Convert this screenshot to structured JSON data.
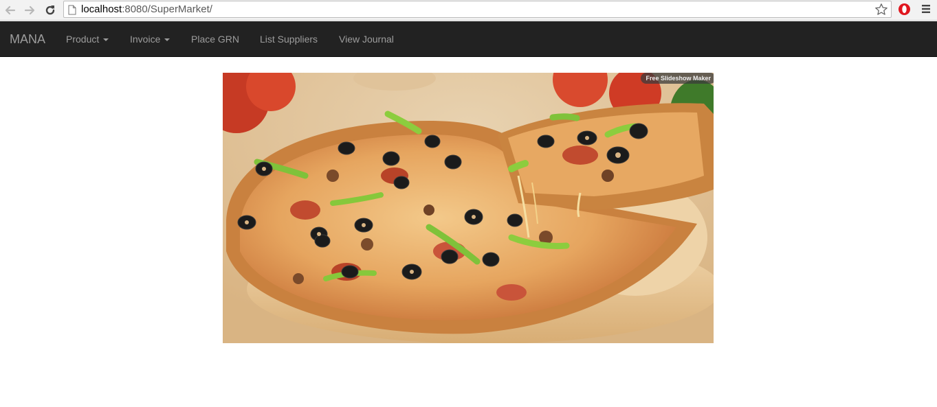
{
  "browser": {
    "url_host": "localhost",
    "url_rest": ":8080/SuperMarket/",
    "icons": {
      "back": "back-arrow-icon",
      "forward": "forward-arrow-icon",
      "reload": "reload-icon",
      "page": "page-icon",
      "bookmark": "star-icon",
      "extension": "opera-icon",
      "menu": "hamburger-menu-icon"
    }
  },
  "navbar": {
    "brand": "MANA",
    "items": [
      {
        "label": "Product",
        "dropdown": true
      },
      {
        "label": "Invoice",
        "dropdown": true
      },
      {
        "label": "Place GRN",
        "dropdown": false
      },
      {
        "label": "List Suppliers",
        "dropdown": false
      },
      {
        "label": "View Journal",
        "dropdown": false
      }
    ],
    "colors": {
      "background": "#222222",
      "text": "#9d9d9d"
    }
  },
  "slideshow": {
    "image_subject": "pizza",
    "watermark": "Free Slideshow Maker"
  }
}
